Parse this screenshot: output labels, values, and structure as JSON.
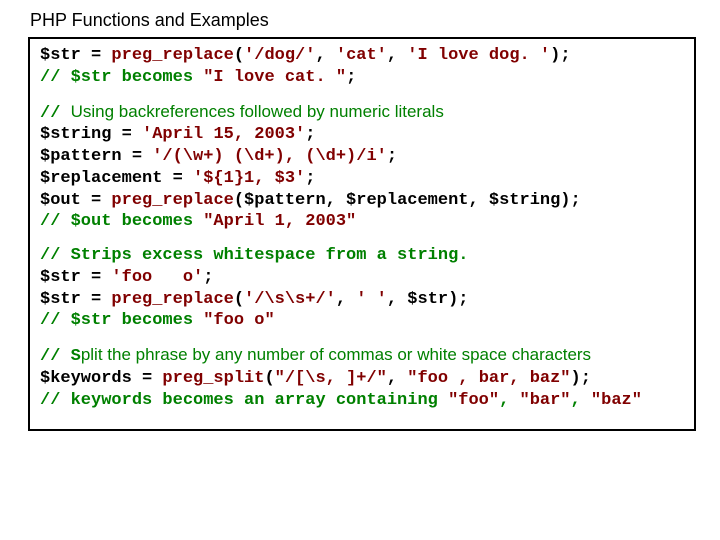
{
  "title": "PHP Functions and Examples",
  "sec1": {
    "l1a": "$str = ",
    "l1b": "preg_replace",
    "l1c": "(",
    "l1d": "'/dog/'",
    "l1e": ", ",
    "l1f": "'cat'",
    "l1g": ", ",
    "l1h": "'I love dog. '",
    "l1i": ");",
    "l2a": "// $str becomes ",
    "l2b": "\"I love cat. \"",
    "l2c": ";"
  },
  "sec2": {
    "c1_slash": "// ",
    "c1_text": " Using backreferences followed by numeric literals",
    "l1a": "$string = ",
    "l1b": "'April 15, 2003'",
    "l1c": ";",
    "l2a": "$pattern = ",
    "l2b": "'/(\\w+) (\\d+), (\\d+)/i'",
    "l2c": ";",
    "l3a": "$replacement = ",
    "l3b": "'${1}1, $3'",
    "l3c": ";",
    "l4a": "$out = ",
    "l4b": "preg_replace",
    "l4c": "($pattern, $replacement, $string);",
    "l5a": "// $out becomes ",
    "l5b": "\"April 1, 2003\""
  },
  "sec3": {
    "l1": "// Strips excess whitespace from a string.",
    "l2a": "$str = ",
    "l2b": "'foo   o'",
    "l2c": ";",
    "l3a": "$str = ",
    "l3b": "preg_replace",
    "l3c": "(",
    "l3d": "'/\\s\\s+/'",
    "l3e": ", ",
    "l3f": "' '",
    "l3g": ", $str);",
    "l4a": "// $str becomes ",
    "l4b": "\"foo o\""
  },
  "sec4": {
    "c1_slash": "// ",
    "c1_s": "S",
    "c1_text": "plit the phrase by any number of commas or white space characters",
    "l1a": "$keywords = ",
    "l1b": "preg_split",
    "l1c": "(",
    "l1d": "\"/[\\s, ]+/\"",
    "l1e": ", ",
    "l1f": "\"foo , bar, baz\"",
    "l1g": ");",
    "l2a": "// keywords becomes an array containing ",
    "l2b": "\"foo\"",
    "l2c": ", ",
    "l2d": "\"bar\"",
    "l2e": ", ",
    "l2f": "\"baz\""
  }
}
